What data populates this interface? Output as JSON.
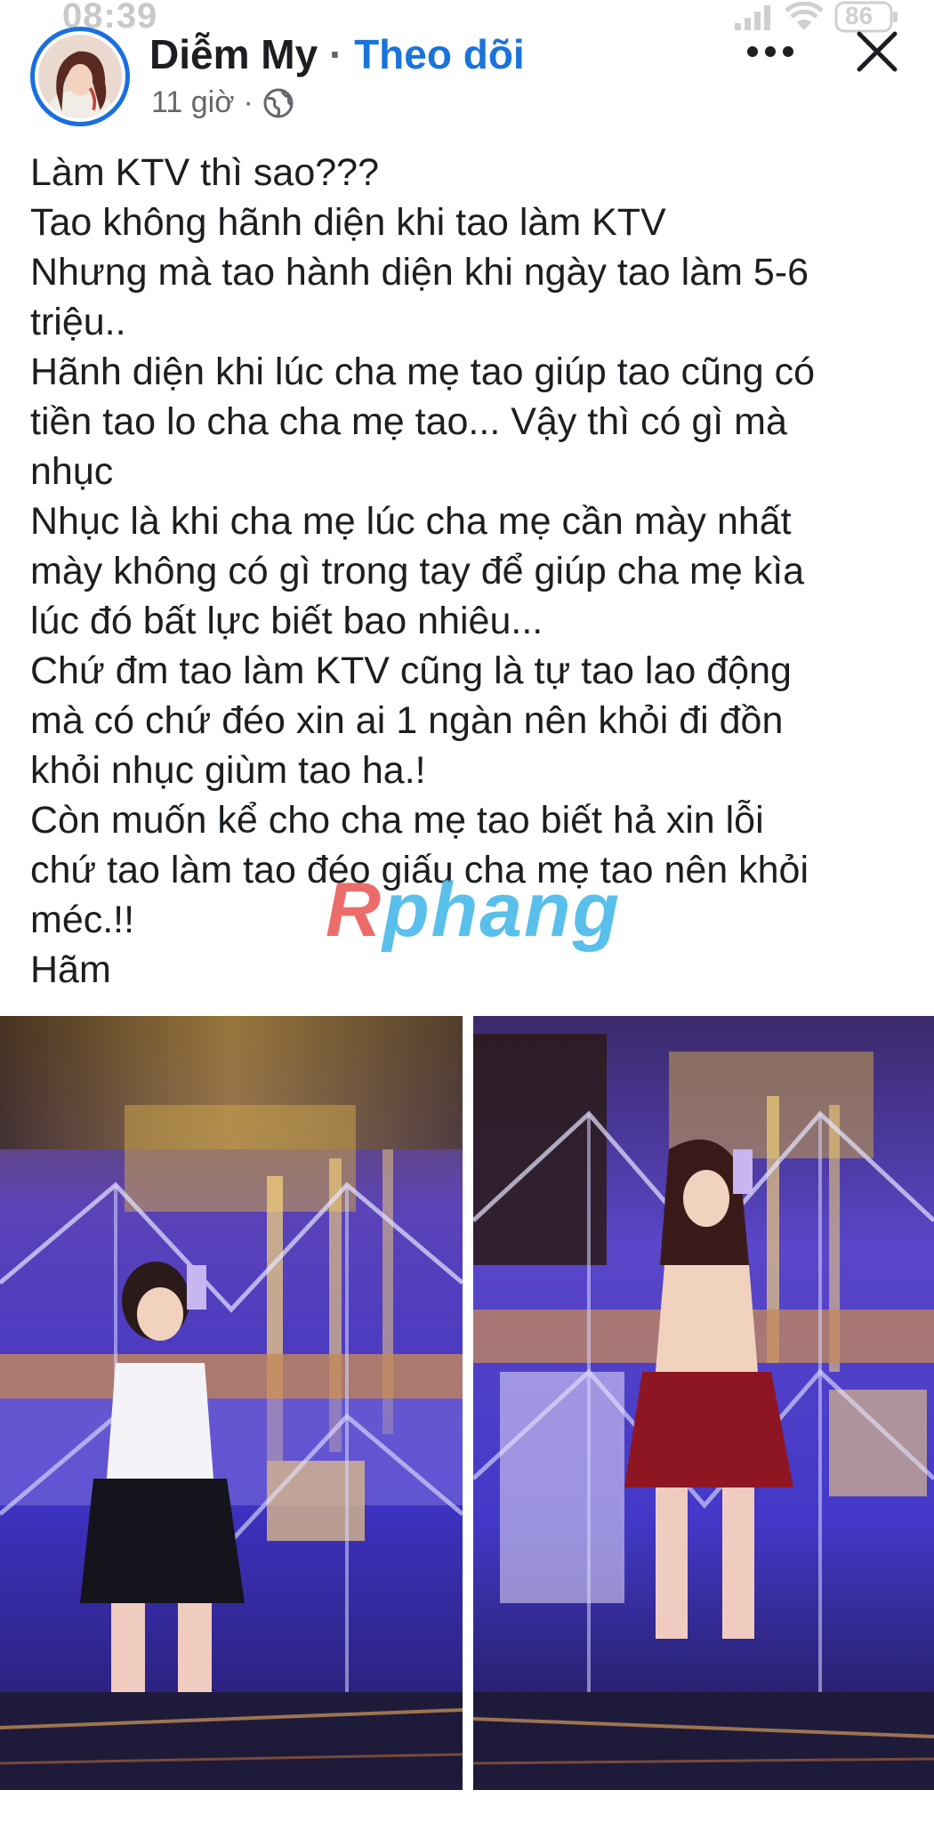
{
  "status_bar": {
    "time": "08:39",
    "battery": "86"
  },
  "post": {
    "author": "Diễm My",
    "separator": "·",
    "follow_label": "Theo dõi",
    "timestamp": "11 giờ",
    "meta_separator": "·",
    "privacy_icon": "globe-icon",
    "lines": [
      "Làm KTV thì sao???",
      "Tao không hãnh diện khi tao làm KTV",
      "Nhưng mà tao hành diện khi ngày tao làm 5-6",
      "triệu..",
      "Hãnh diện khi lúc cha mẹ tao giúp tao cũng có",
      "tiền tao lo cha cha mẹ tao... Vậy thì có gì mà",
      "nhục",
      "Nhục là khi cha mẹ lúc cha mẹ cần mày nhất",
      "mày không có gì trong tay để giúp cha mẹ kìa",
      "lúc đó bất lực biết bao nhiêu...",
      "Chứ đm tao làm KTV cũng là tự tao lao động",
      "mà có chứ đéo xin ai 1 ngàn nên khỏi đi đồn",
      "khỏi nhục giùm tao ha.!",
      "Còn muốn kể cho cha mẹ tao biết hả xin lỗi",
      "chứ tao làm tao đéo giấu cha mẹ tao nên khỏi",
      "méc.!!",
      "Hãm"
    ]
  },
  "watermark": {
    "part_a": "R",
    "part_b": "phang"
  },
  "colors": {
    "follow_blue": "#1a73d9",
    "avatar_ring": "#1a6fe0",
    "meta_gray": "#65676b"
  }
}
